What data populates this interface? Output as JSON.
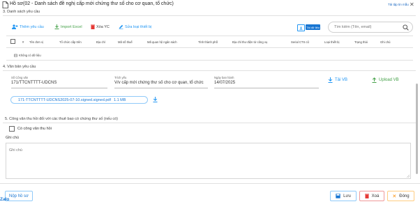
{
  "window": {
    "title": "Hồ sơ(02 - Danh sách đề nghị cấp mới chứng thư số cho cơ quan, tổ chức)",
    "download_template": "Tải tập tin mẫu"
  },
  "section3": {
    "heading": "3. Danh sách yêu cầu",
    "toolbar": {
      "add": "Thêm yêu cầu",
      "import": "Import Excel",
      "delete": "Xóa YC",
      "edit_device": "Sửa loại thiết bị",
      "small_button": "Tải dữ liệu"
    },
    "search": {
      "placeholder": "Tìm kiếm (Tên, email)"
    },
    "columns": [
      "#",
      "Tên đơn vị",
      "Tổ chức cấp trên",
      "Địa chỉ",
      "Mã số thuế",
      "Mã quan hệ ngân sách",
      "Tỉnh thành phố",
      "Địa chỉ thư điện tử công vụ",
      "Serial CTS cũ",
      "Loại thiết bị",
      "Trạng thái",
      "Ghi chú"
    ],
    "empty_text": "Không có dữ liệu"
  },
  "section4": {
    "heading": "4. Văn bản yêu cầu",
    "doc_number_label": "Số Công văn",
    "doc_number": "171/TTCNTTTT-UDCNS",
    "summary_label": "Trích yếu",
    "summary": "V/v cấp mới chứng thư số cho cơ quan, tổ chức",
    "issue_date_label": "Ngày ban hành",
    "issue_date": "14/07/2025",
    "download_label": "Tải VB",
    "upload_label": "Upload VB",
    "attachment": {
      "name": "171-TTCNTTTT-UDCNS2025-07-10.signed.signed.pdf",
      "size": "1.1 MB"
    }
  },
  "section5": {
    "heading": "5. Công văn thu hồi đối với các thuê bao có chứng thư số (nếu có)",
    "checkbox_label": "Có công văn thu hồi"
  },
  "notes": {
    "label": "Ghi chú",
    "placeholder": "Ghi chú"
  },
  "footer": {
    "submit": "Nộp hồ sơ",
    "save": "Lưu",
    "delete": "Xoá",
    "close": "Đóng"
  },
  "brand": "Zalo",
  "colors": {
    "primary": "#2196f3",
    "success": "#43a047",
    "danger": "#e53935",
    "warning": "#fb8c00"
  }
}
